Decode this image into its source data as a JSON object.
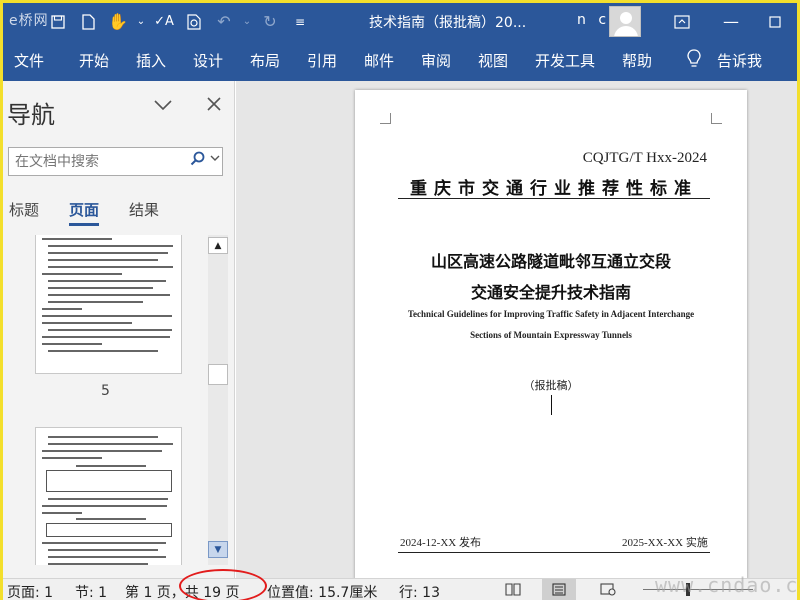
{
  "titlebar": {
    "watermark_logo": "e桥网",
    "document_title": "技术指南（报批稿）20...",
    "user_initials": "n c",
    "icons": [
      "save-icon",
      "new-doc-icon",
      "touch-mode-icon",
      "spelling-icon",
      "print-preview-icon",
      "undo-icon",
      "redo-icon",
      "customize-qa-icon",
      "ribbon-display-icon"
    ]
  },
  "ribbon": {
    "tabs": [
      "文件",
      "开始",
      "插入",
      "设计",
      "布局",
      "引用",
      "邮件",
      "审阅",
      "视图",
      "开发工具",
      "帮助"
    ],
    "tell_me": "告诉我",
    "color": "#2b579a"
  },
  "navigation": {
    "title": "导航",
    "search_placeholder": "在文档中搜索",
    "tabs": [
      "标题",
      "页面",
      "结果"
    ],
    "active_tab": "页面",
    "page_thumbnail_label": "5"
  },
  "document": {
    "code": "CQJTG/T  Hxx-2024",
    "standard_type": "重庆市交通行业推荐性标准",
    "title_line1": "山区高速公路隧道毗邻互通立交段",
    "title_line2": "交通安全提升技术指南",
    "title_en_line1": "Technical Guidelines for Improving Traffic Safety in Adjacent Interchange",
    "title_en_line2": "Sections of Mountain Expressway Tunnels",
    "draft_status": "（报批稿）",
    "publish_date": "2024-12-XX 发布",
    "implement_date": "2025-XX-XX 实施"
  },
  "statusbar": {
    "page": "页面: 1",
    "section": "节: 1",
    "page_of": "第 1 页，共 19 页",
    "position": "位置值: 15.7厘米",
    "line": "行: 13",
    "watermark": "www.cndao.com"
  }
}
